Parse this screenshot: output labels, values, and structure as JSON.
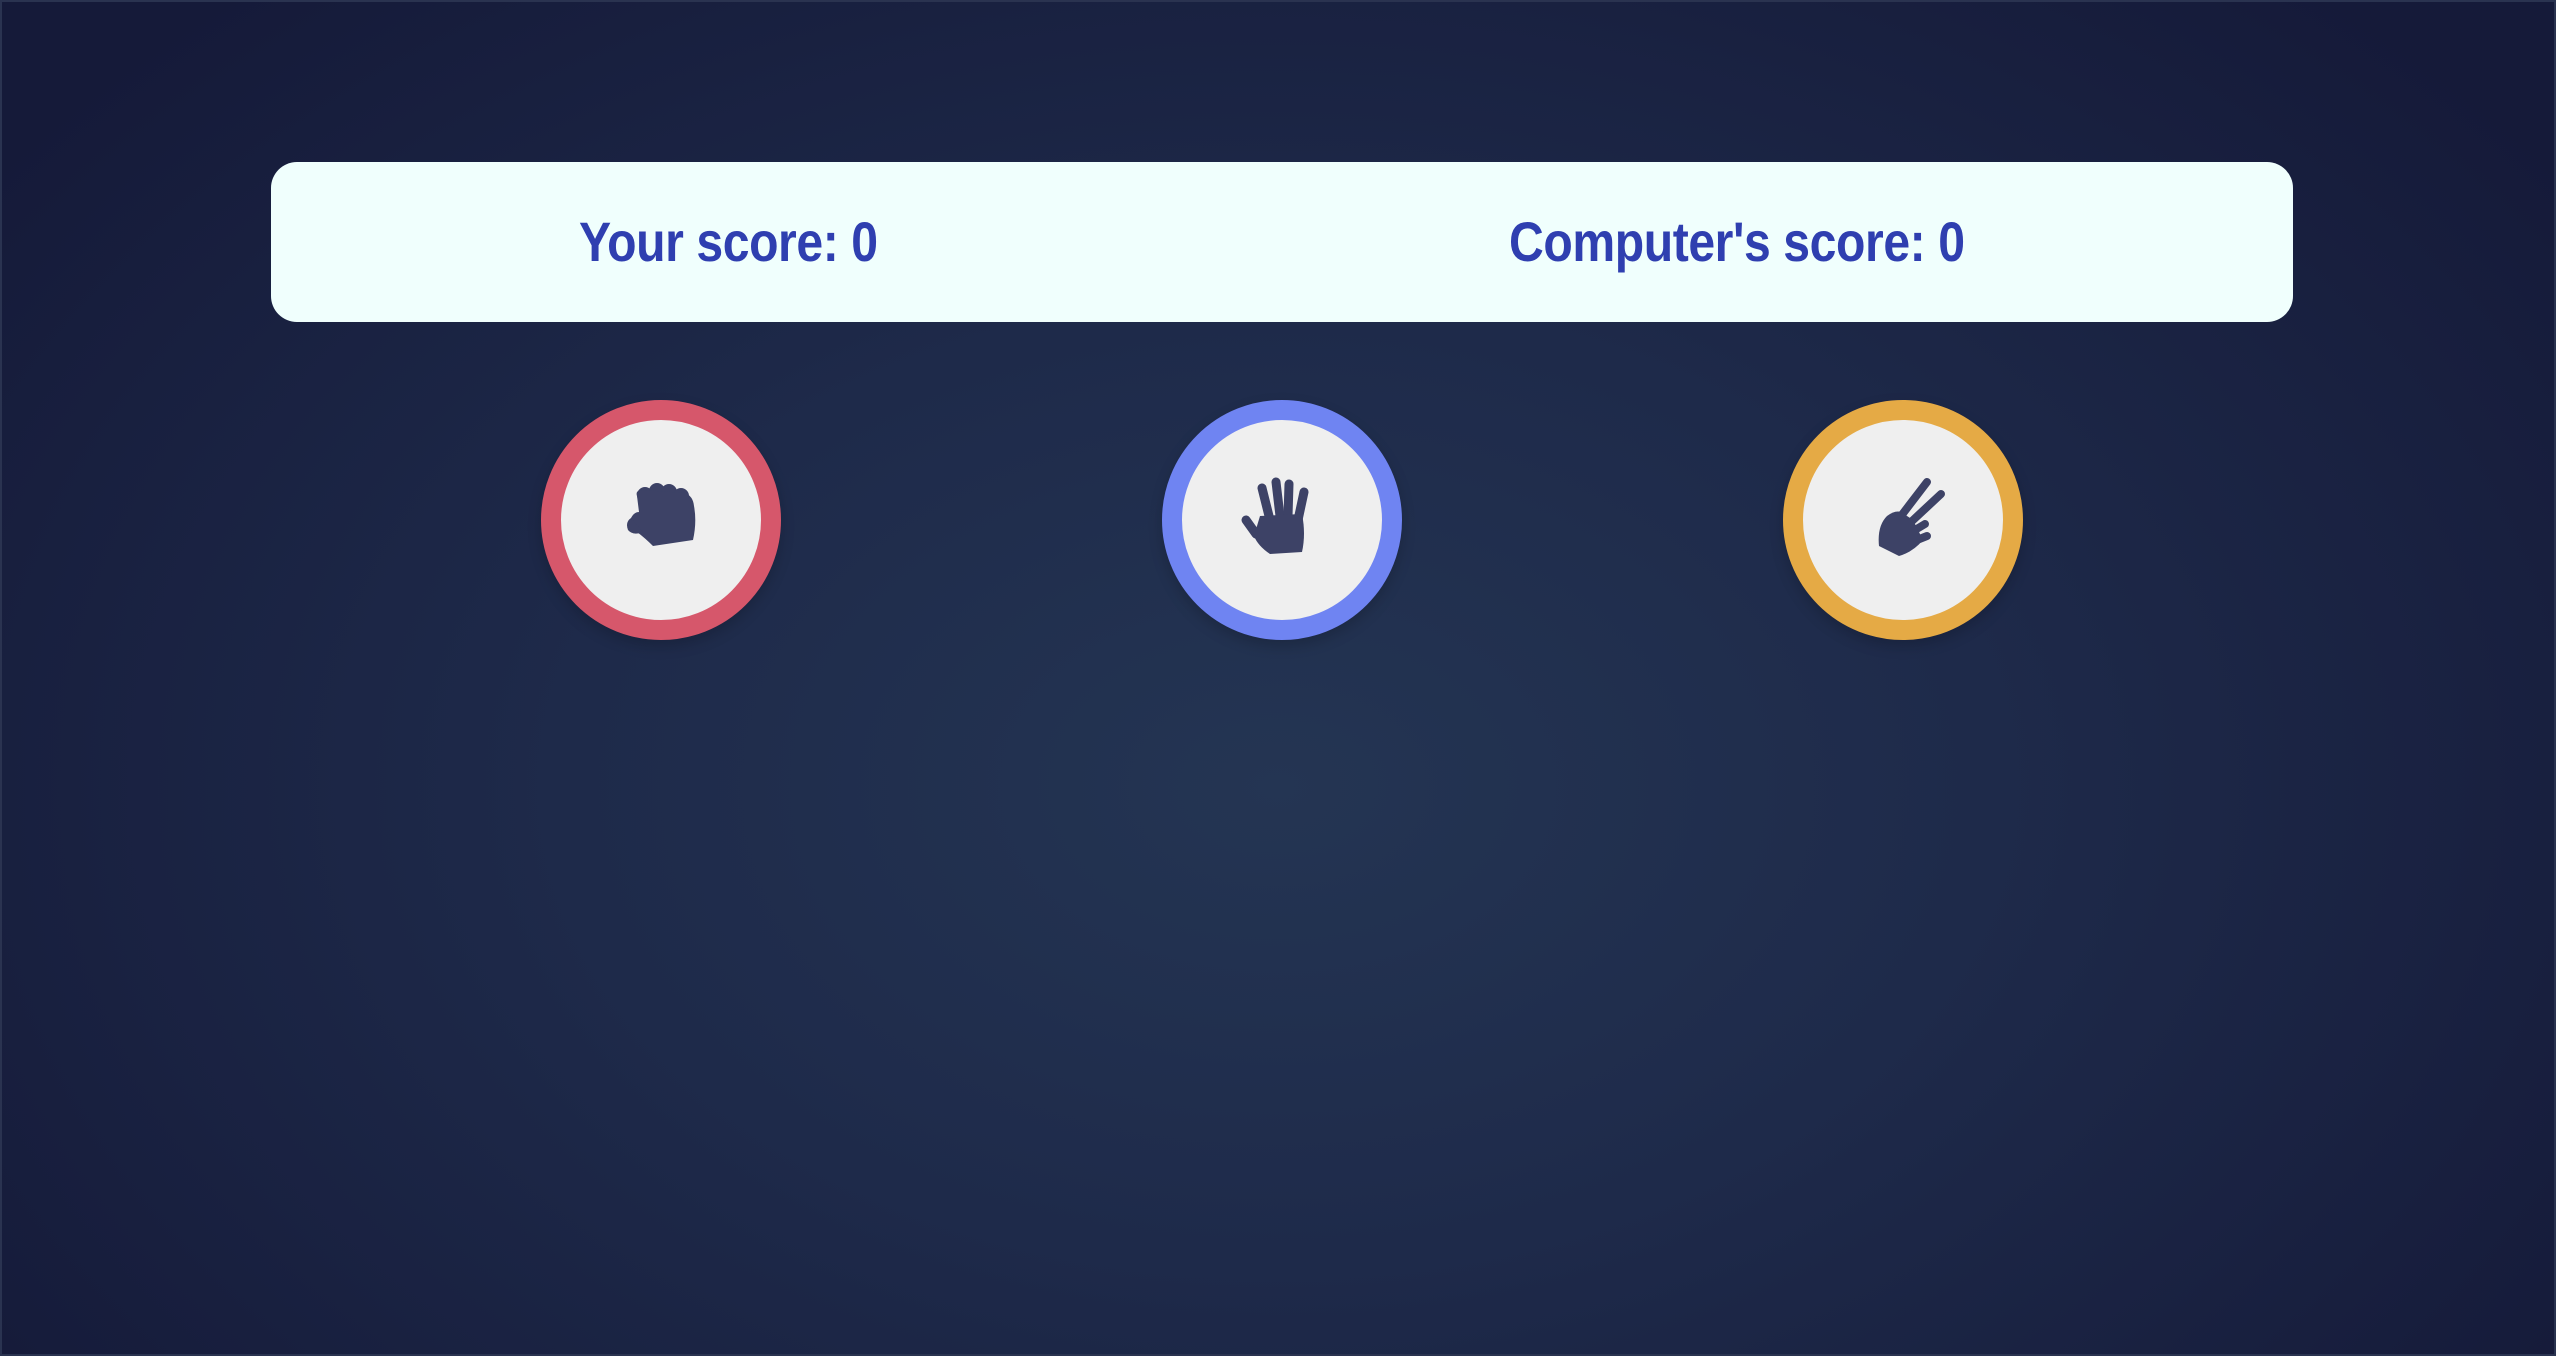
{
  "scoreboard": {
    "player_label": "Your score:",
    "player_score": "0",
    "computer_label": "Computer's score:",
    "computer_score": "0"
  },
  "choices": [
    {
      "name": "rock",
      "icon": "rock-hand-icon",
      "ring_color": "#d6576b"
    },
    {
      "name": "paper",
      "icon": "paper-hand-icon",
      "ring_color": "#6f84f2"
    },
    {
      "name": "scissors",
      "icon": "scissors-hand-icon",
      "ring_color": "#e5aa45"
    }
  ],
  "colors": {
    "score_text": "#2f3fb0",
    "scoreboard_bg": "#f0fffd",
    "icon_fill": "#3d4266",
    "choice_bg": "#efefef"
  }
}
